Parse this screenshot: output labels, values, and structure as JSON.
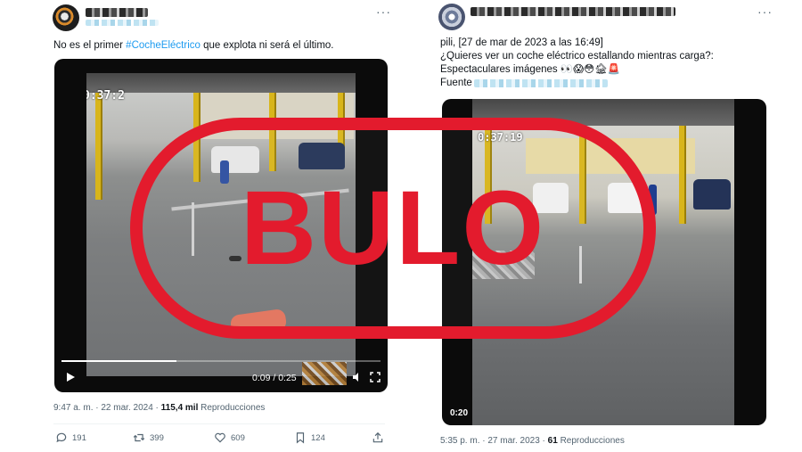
{
  "left_tweet": {
    "text_prefix": "No es el primer ",
    "hashtag": "#CocheEléctrico",
    "text_suffix": " que explota ni será el último.",
    "video": {
      "timestamp_overlay": "0:37:2",
      "time_readout": "0:09 / 0:25",
      "progress": 0.36
    },
    "meta": {
      "time": "9:47 a. m.",
      "separator": "·",
      "date": "22 mar. 2024",
      "views": "115,4 mil",
      "views_label": "Reproducciones"
    },
    "actions": {
      "replies": "191",
      "reposts": "399",
      "likes": "609",
      "bookmarks": "124"
    }
  },
  "right_tweet": {
    "line1": "pili, [27 de mar de 2023 a las 16:49]",
    "line2": "¿Quieres ver un coche eléctrico estallando mientras carga?:",
    "line3": "Espectaculares imágenes 👀😱😳🏚🚨",
    "line4_label": "Fuente",
    "video": {
      "timestamp_overlay": "0:37:19",
      "duration": "0:20"
    },
    "meta": {
      "time": "5:35 p. m.",
      "separator": "·",
      "date": "27 mar. 2023",
      "views": "61",
      "views_label": "Reproducciones"
    }
  },
  "overlay": {
    "stamp_text": "BULO",
    "stamp_color": "#e31b2d"
  },
  "colors": {
    "link": "#1d9bf0",
    "muted": "#536471",
    "text": "#0f1419"
  }
}
